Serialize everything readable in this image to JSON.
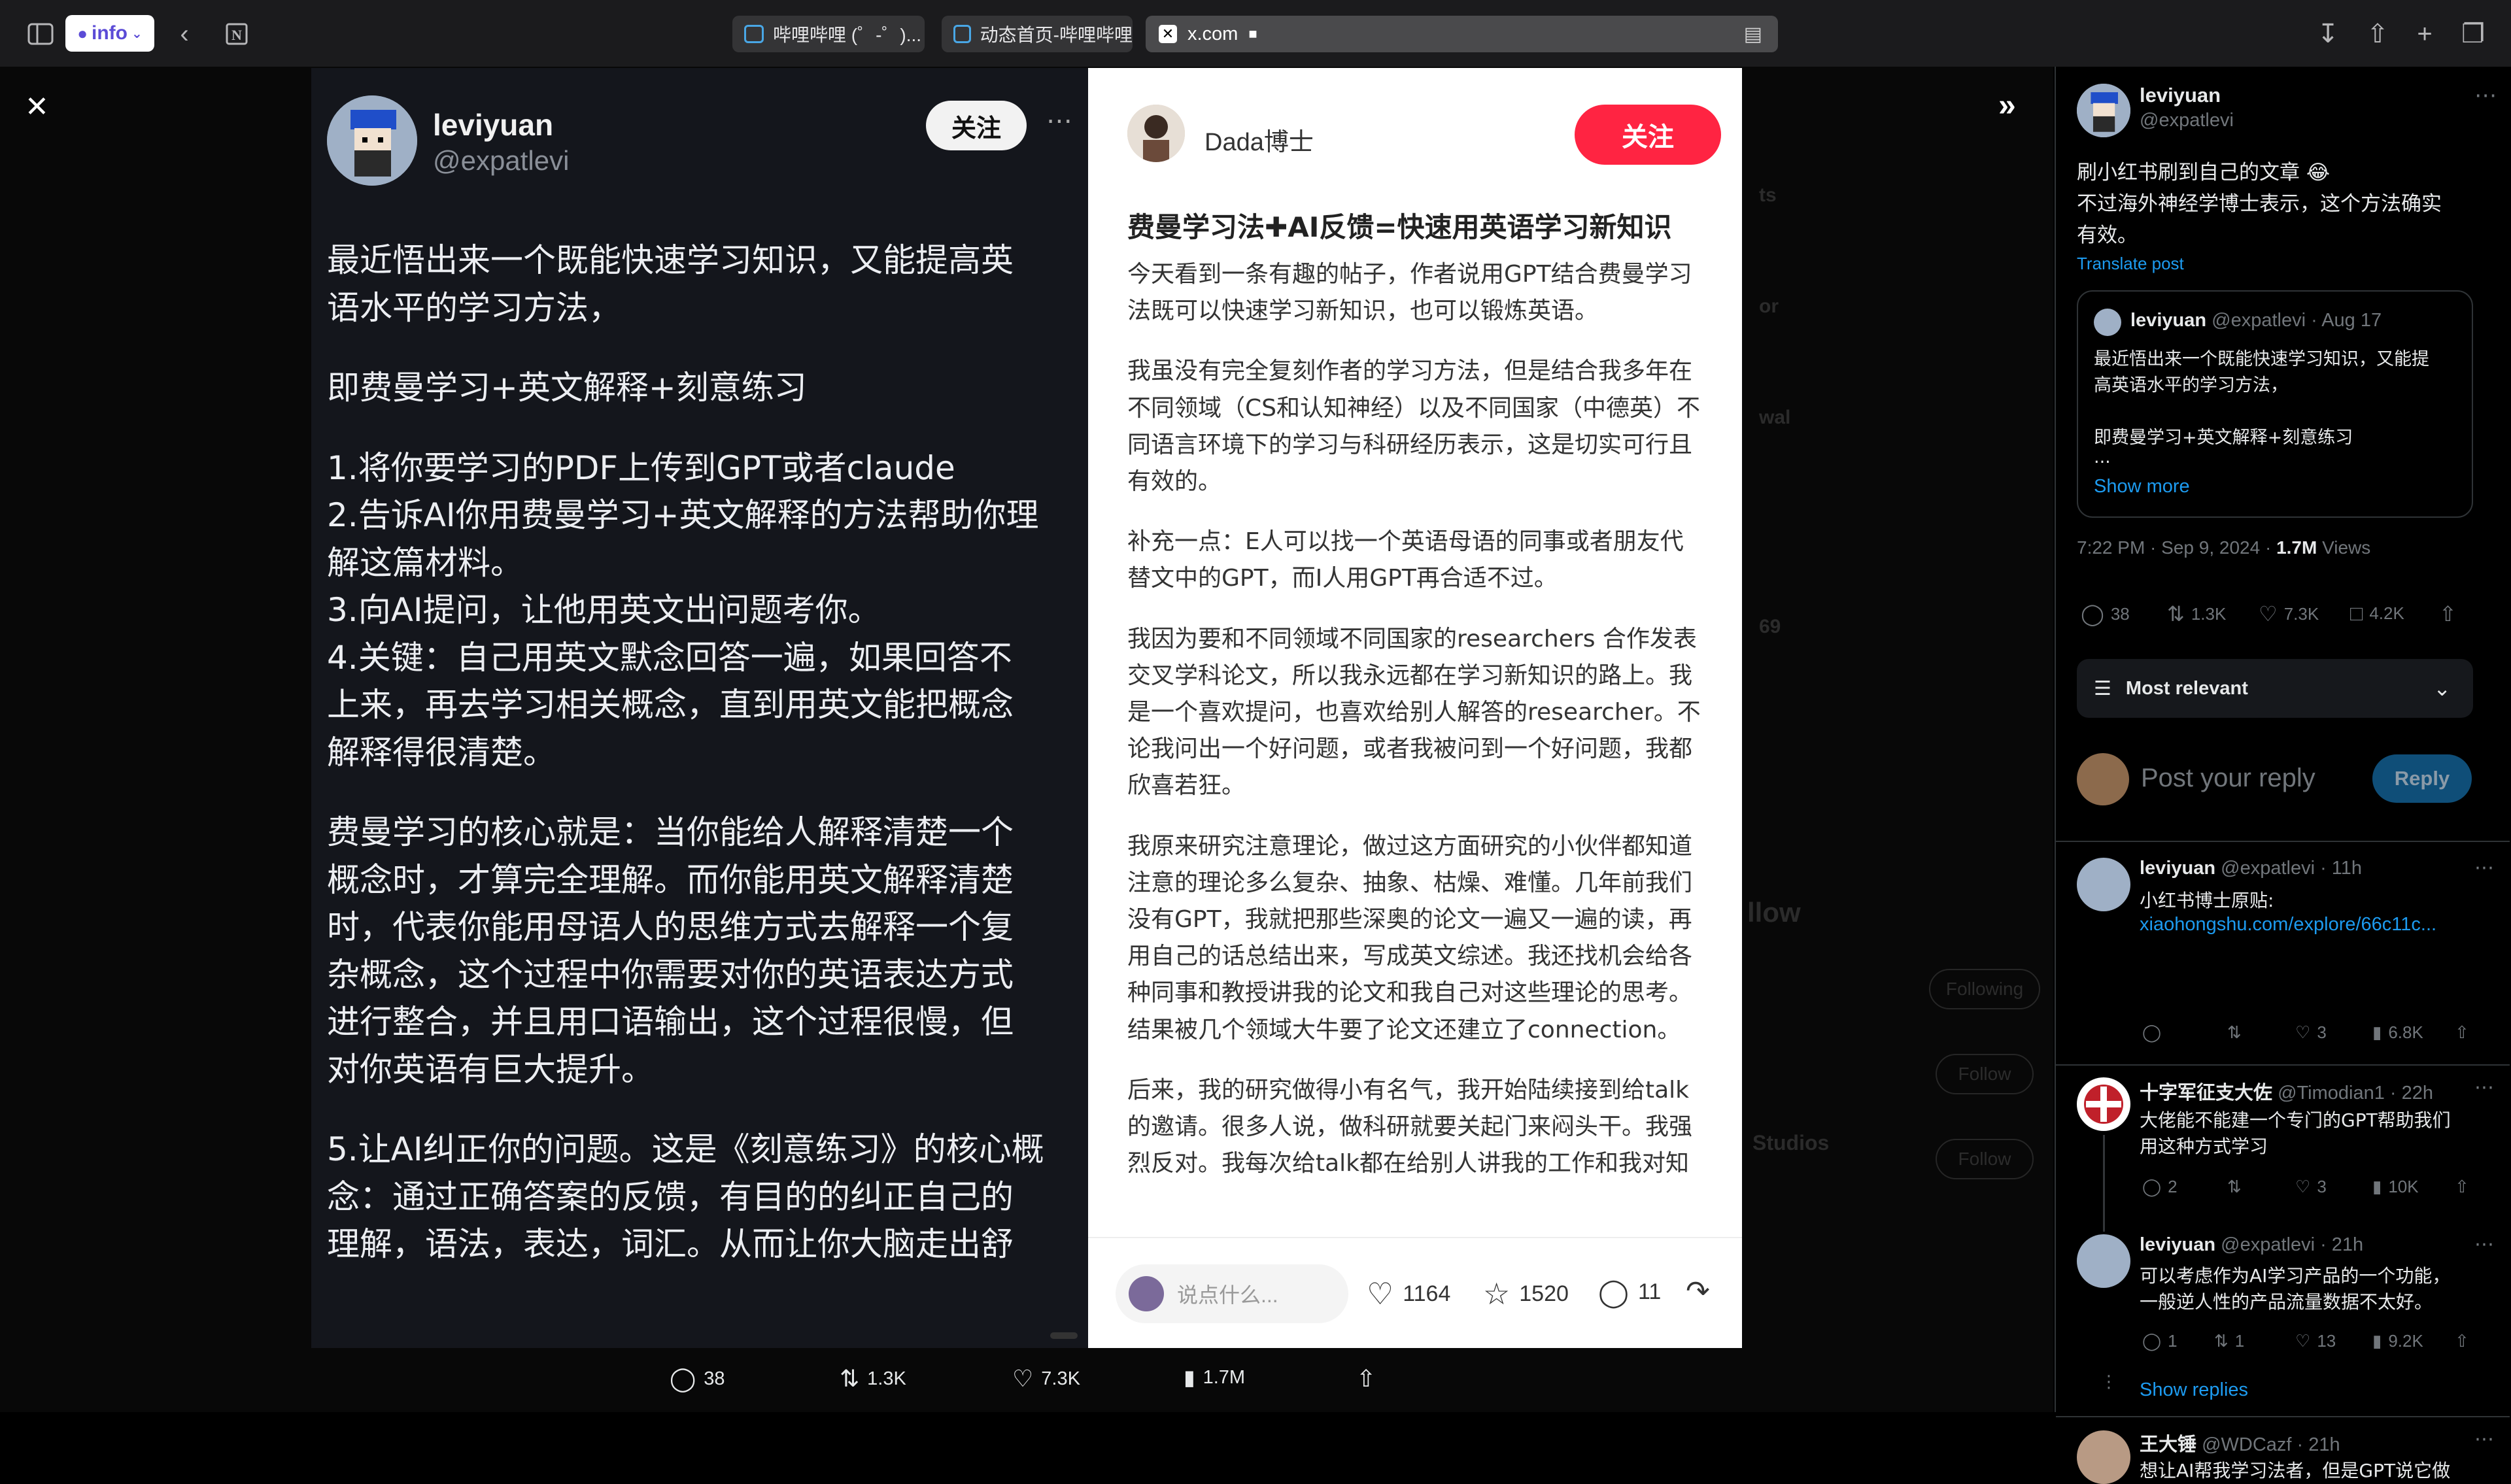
{
  "browser": {
    "profile_label": "info",
    "tabs": [
      {
        "title": "哔哩哔哩 (゜-゜)..."
      },
      {
        "title": "动态首页-哔哩哔哩"
      }
    ],
    "address": "x.com"
  },
  "left_image": {
    "author_name": "leviyuan",
    "author_handle": "@expatlevi",
    "follow_label": "关注",
    "lines": [
      "最近悟出来一个既能快速学习知识，又能提高英",
      "语水平的学习方法，",
      "",
      "即费曼学习+英文解释+刻意练习",
      "",
      "1.将你要学习的PDF上传到GPT或者claude",
      "2.告诉AI你用费曼学习+英文解释的方法帮助你理",
      "解这篇材料。",
      "3.向AI提问，让他用英文出问题考你。",
      "4.关键：自己用英文默念回答一遍，如果回答不",
      "上来，再去学习相关概念，直到用英文能把概念",
      "解释得很清楚。",
      "",
      "费曼学习的核心就是：当你能给人解释清楚一个",
      "概念时，才算完全理解。而你能用英文解释清楚",
      "时，代表你能用母语人的思维方式去解释一个复",
      "杂概念，这个过程中你需要对你的英语表达方式",
      "进行整合，并且用口语输出，这个过程很慢，但",
      "对你英语有巨大提升。",
      "",
      "5.让AI纠正你的问题。这是《刻意练习》的核心概",
      "念：通过正确答案的反馈，有目的的纠正自己的",
      "理解，语法，表达，词汇。从而让你大脑走出舒"
    ]
  },
  "right_image": {
    "author_name": "Dada博士",
    "follow_label": "关注",
    "title": "费曼学习法✚AI反馈=快速用英语学习新知识",
    "lines": [
      "今天看到一条有趣的帖子，作者说用GPT结合费曼学习",
      "法既可以快速学习新知识，也可以锻炼英语。",
      "",
      "我虽没有完全复刻作者的学习方法，但是结合我多年在",
      "不同领域（CS和认知神经）以及不同国家（中德英）不",
      "同语言环境下的学习与科研经历表示，这是切实可行且",
      "有效的。",
      "",
      "补充一点：E人可以找一个英语母语的同事或者朋友代",
      "替文中的GPT，而I人用GPT再合适不过。",
      "",
      "我因为要和不同领域不同国家的researchers 合作发表",
      "交叉学科论文，所以我永远都在学习新知识的路上。我",
      "是一个喜欢提问，也喜欢给别人解答的researcher。不",
      "论我问出一个好问题，或者我被问到一个好问题，我都",
      "欣喜若狂。",
      "",
      "我原来研究注意理论，做过这方面研究的小伙伴都知道",
      "注意的理论多么复杂、抽象、枯燥、难懂。几年前我们",
      "没有GPT，我就把那些深奥的论文一遍又一遍的读，再",
      "用自己的话总结出来，写成英文综述。我还找机会给各",
      "种同事和教授讲我的论文和我自己对这些理论的思考。",
      "结果被几个领域大牛要了论文还建立了connection。",
      "",
      "后来，我的研究做得小有名气，我开始陆续接到给talk",
      "的邀请。很多人说，做科研就要关起门来闷头干。我强",
      "烈反对。我每次给talk都在给别人讲我的工作和我对知"
    ],
    "comment_placeholder": "说点什么...",
    "likes": "1164",
    "favorites": "1520",
    "comments": "11"
  },
  "bottom_stats": {
    "replies": "38",
    "reposts": "1.3K",
    "likes": "7.3K",
    "views": "1.7M"
  },
  "background_ghost": {
    "items": [
      "ts",
      "or",
      "wal",
      "69",
      "llow"
    ],
    "buttons": [
      "Following",
      "Follow",
      "Follow"
    ],
    "studio": "Studios"
  },
  "sidebar": {
    "post": {
      "name": "leviyuan",
      "handle": "@expatlevi",
      "text_line1": "刷小红书刷到自己的文章 😂",
      "text_line2": "不过海外神经学博士表示，这个方法确实",
      "text_line3": "有效。",
      "translate": "Translate post",
      "quote": {
        "name": "leviyuan",
        "handle": "@expatlevi",
        "date": "· Aug 17",
        "line1": "最近悟出来一个既能快速学习知识，又能提",
        "line2": "高英语水平的学习方法，",
        "line3": "即费曼学习+英文解释+刻意练习",
        "ellipsis": "...",
        "show_more": "Show more"
      },
      "timestamp": "7:22 PM · Sep 9, 2024 · ",
      "views": "1.7M",
      "views_label": " Views",
      "replies": "38",
      "reposts": "1.3K",
      "likes": "7.3K",
      "bookmarks": "4.2K"
    },
    "sort_label": "Most relevant",
    "reply_placeholder": "Post your reply",
    "reply_button": "Reply",
    "replies": [
      {
        "name": "leviyuan",
        "handle": "@expatlevi · 11h",
        "line1": "小红书博士原贴:",
        "link": "xiaohongshu.com/explore/66c11c...",
        "comments": "",
        "reposts": "",
        "likes": "3",
        "views": "6.8K"
      },
      {
        "name": "十字军征支大佐",
        "handle": "@Timodian1 · 22h",
        "line1": "大佬能不能建一个专门的GPT帮助我们",
        "line2": "用这种方式学习",
        "comments": "2",
        "reposts": "",
        "likes": "3",
        "views": "10K"
      },
      {
        "name": "leviyuan",
        "handle": "@expatlevi · 21h",
        "line1": "可以考虑作为AI学习产品的一个功能，",
        "line2": "一般逆人性的产品流量数据不太好。",
        "comments": "1",
        "reposts": "1",
        "likes": "13",
        "views": "9.2K"
      },
      {
        "name": "王大锤",
        "handle": "@WDCazf · 21h",
        "line1": "想让AI帮我学习法者，但是GPT说它做"
      }
    ],
    "show_replies": "Show replies"
  }
}
